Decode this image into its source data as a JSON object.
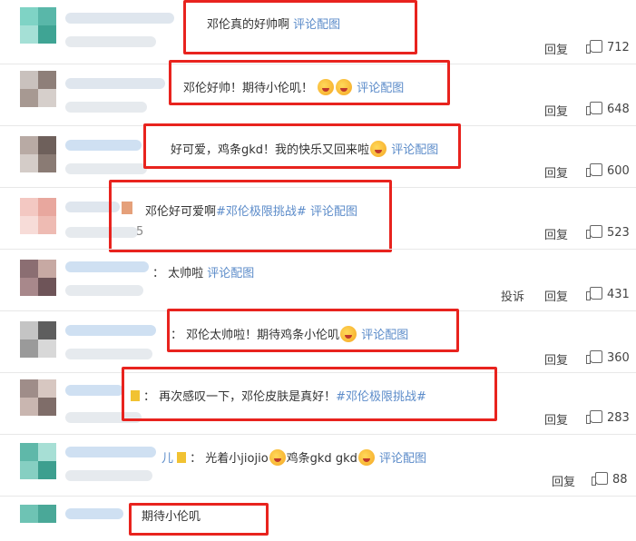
{
  "comments": [
    {
      "text_before": "邓伦真的好帅啊",
      "link": "评论配图",
      "reply": "回复",
      "likes": "712"
    },
    {
      "text_before": "邓伦好帅！期待小伦叽！",
      "link": "评论配图",
      "reply": "回复",
      "likes": "648"
    },
    {
      "text_before": "好可爱，鸡条gkd！我的快乐又回来啦",
      "link": "评论配图",
      "reply": "回复",
      "likes": "600"
    },
    {
      "text_before": "邓伦好可爱啊",
      "hashtag": "#邓伦极限挑战#",
      "link": "评论配图",
      "reply": "回复",
      "likes": "523",
      "tail": "5"
    },
    {
      "text_before": "：  太帅啦",
      "link": "评论配图",
      "report": "投诉",
      "reply": "回复",
      "likes": "431"
    },
    {
      "text_before": "：  邓伦太帅啦！期待鸡条小伦叽",
      "link": "评论配图",
      "reply": "回复",
      "likes": "360"
    },
    {
      "text_before": "：  再次感叹一下，邓伦皮肤是真好！",
      "hashtag": "#邓伦极限挑战#",
      "reply": "回复",
      "likes": "283"
    },
    {
      "prefix": "儿",
      "text_before": "：  光着小jiojio",
      "text_mid": "鸡条gkd gkd",
      "link": "评论配图",
      "reply": "回复",
      "likes": "88"
    },
    {
      "text_before": "期待小伦叽"
    }
  ],
  "colors": {
    "highlight_box": "#e8231e",
    "link": "#5b8bc9"
  },
  "icons": {
    "like": "thumbs-up-icon",
    "emoji": "emoji-icon"
  }
}
